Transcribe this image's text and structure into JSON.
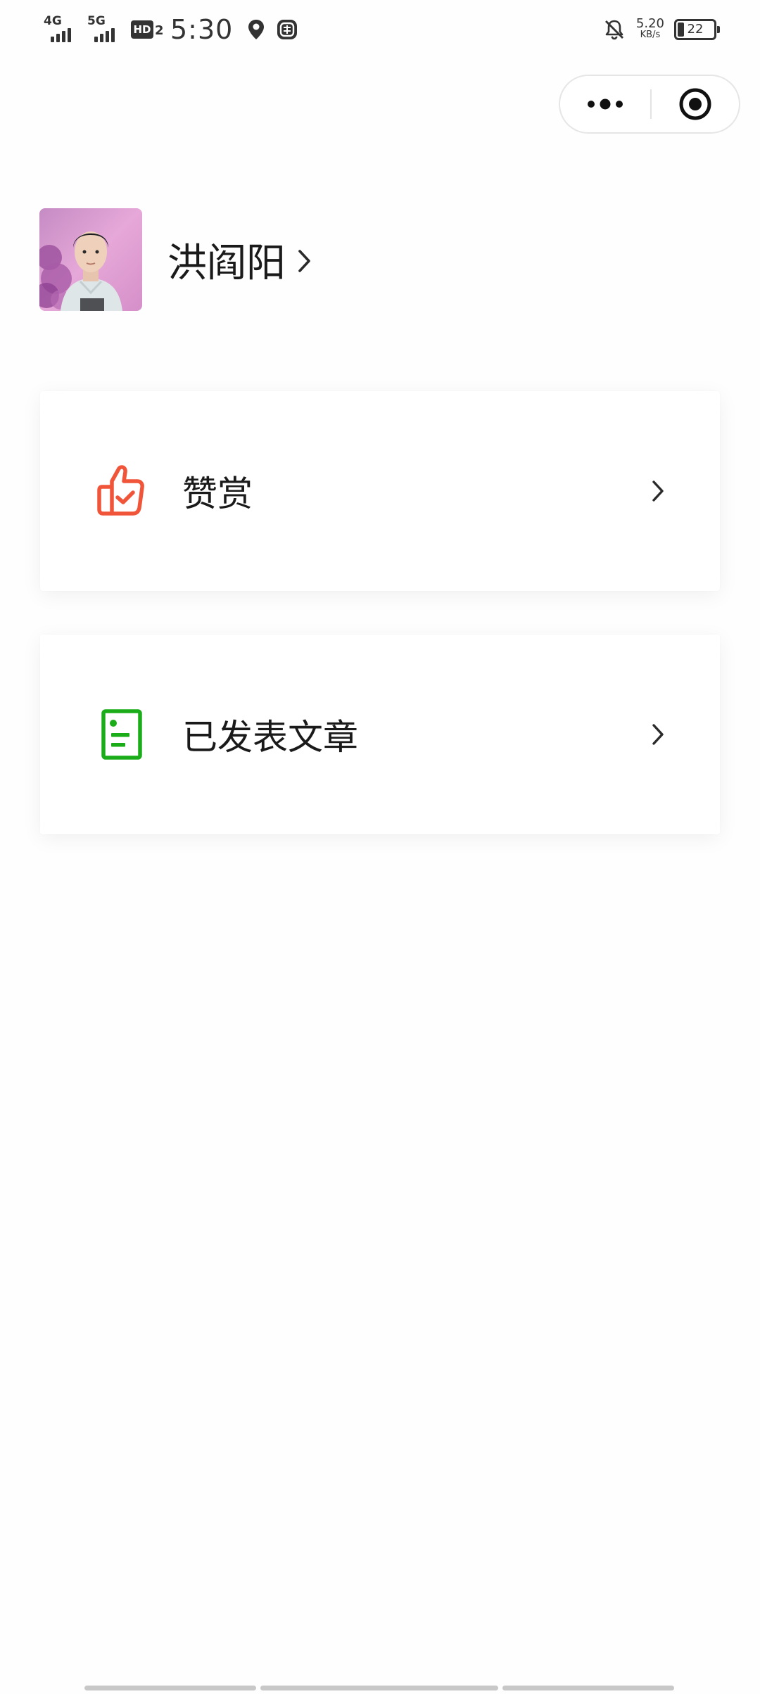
{
  "status_bar": {
    "network_1": "4G",
    "network_2": "5G",
    "hd_label": "HD",
    "hd_sub": "2",
    "time": "5:30",
    "speed_value": "5.20",
    "speed_unit": "KB/s",
    "battery_level": "22",
    "icons": [
      "signal-4g-icon",
      "signal-5g-icon",
      "hd-voice-icon",
      "location-icon",
      "app-notification-icon",
      "bell-muted-icon",
      "battery-icon"
    ]
  },
  "capsule": {
    "more_icon": "more-dots-icon",
    "close_icon": "target-circle-icon"
  },
  "profile": {
    "name": "洪阎阳",
    "chevron": "chevron-right-icon"
  },
  "menu": {
    "items": [
      {
        "label": "赞赏",
        "icon": "thumbs-up-check-icon",
        "color": "#F0553A"
      },
      {
        "label": "已发表文章",
        "icon": "document-list-icon",
        "color": "#1AAD19"
      }
    ]
  },
  "colors": {
    "reward_accent": "#F0553A",
    "article_accent": "#1AAD19",
    "text_primary": "#1a1a1a",
    "background": "#fefefe"
  }
}
